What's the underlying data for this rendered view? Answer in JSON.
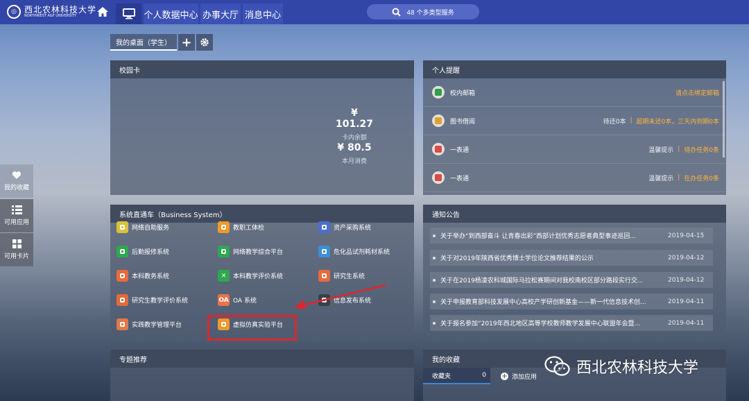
{
  "header": {
    "logo_cn": "西北农林科技大学",
    "logo_en": "NORTHWEST A&F UNIVERSITY",
    "nav": [
      "个人数据中心",
      "办事大厅",
      "消息中心"
    ],
    "search_text": "48 个多类型服务"
  },
  "desktop": {
    "tab_label": "我的桌面（学生）",
    "add_label": "+",
    "settings_icon": "gear-icon"
  },
  "sidebar": {
    "items": [
      {
        "label": "我的收藏",
        "icon": "heart-icon"
      },
      {
        "label": "可用应用",
        "icon": "list-icon"
      },
      {
        "label": "可用卡片",
        "icon": "grid-icon"
      }
    ]
  },
  "campus_card": {
    "title": "校园卡",
    "balance": "¥ 101.27",
    "balance_label": "卡内余额",
    "monthly": "¥ 80.5",
    "monthly_label": "本月消费"
  },
  "reminders": {
    "title": "个人提醒",
    "rows": [
      {
        "title": "校内邮箱",
        "info": "",
        "action": "请点击绑定邮箱",
        "color": "#2e9e4f"
      },
      {
        "title": "图书借阅",
        "info": "待还0本",
        "action": "超期未还0本，三天内到期0本",
        "color": "#d9a238"
      },
      {
        "title": "一表通",
        "info": "温馨提示",
        "action": "待办任务0条",
        "color": "#d94a4a"
      },
      {
        "title": "一表通",
        "info": "温馨提示",
        "action": "在办任务0条",
        "color": "#d94a4a"
      }
    ]
  },
  "systems": {
    "title": "系统直通车（Business System）",
    "items": [
      {
        "label": "网络自助服务",
        "color": "#d9c23a",
        "glyph": ""
      },
      {
        "label": "教职工体检",
        "color": "#f0982a",
        "glyph": ""
      },
      {
        "label": "资产采购系统",
        "color": "#4a6fd1",
        "glyph": ""
      },
      {
        "label": "后勤报修系统",
        "color": "#2ea84f",
        "glyph": ""
      },
      {
        "label": "网络教学综合平台",
        "color": "#2ea84f",
        "glyph": ""
      },
      {
        "label": "危化品试剂耗材系统",
        "color": "#3c8fd6",
        "glyph": ""
      },
      {
        "label": "本科教务系统",
        "color": "#ea6a3a",
        "glyph": ""
      },
      {
        "label": "本科教学评价系统",
        "color": "#2ea84f",
        "glyph": "✕"
      },
      {
        "label": "研究生系统",
        "color": "#ea6a3a",
        "glyph": ""
      },
      {
        "label": "研究生教学评价系统",
        "color": "#e06a3a",
        "glyph": ""
      },
      {
        "label": "OA 系统",
        "color": "#e8734a",
        "glyph": "OA"
      },
      {
        "label": "信息发布系统",
        "color": "#3a3f4a",
        "glyph": ""
      },
      {
        "label": "实践教学管理平台",
        "color": "#e07a4a",
        "glyph": ""
      },
      {
        "label": "虚拟仿真实验平台",
        "color": "#f0982a",
        "glyph": ""
      }
    ]
  },
  "notices": {
    "title": "通知公告",
    "rows": [
      {
        "title": "关于举办“到西部奋斗 让青春出彩”西部计划优秀志愿者典型事迹巡回...",
        "date": "2019-04-15"
      },
      {
        "title": "关于对2019年陕西省优秀博士学位论文推荐结果的公示",
        "date": "2019-04-12"
      },
      {
        "title": "关于在2019杨凌农科城国际马拉松赛期间对我校南校区部分路段实行交...",
        "date": "2019-04-12"
      },
      {
        "title": "关于申报教育部科技发展中心高校产学研创新基金——新一代信息技术创...",
        "date": "2019-04-11"
      },
      {
        "title": "关于报名参加“2019年西北地区高等学校教师教学发展中心联盟年会暨...",
        "date": "2019-04-11"
      }
    ]
  },
  "topics": {
    "title": "专题推荐"
  },
  "favorites": {
    "title": "我的收藏",
    "folder_label": "收藏夹",
    "folder_count": "0",
    "add_label": "添加应用"
  },
  "watermark": {
    "text": "西北农林科技大学"
  }
}
